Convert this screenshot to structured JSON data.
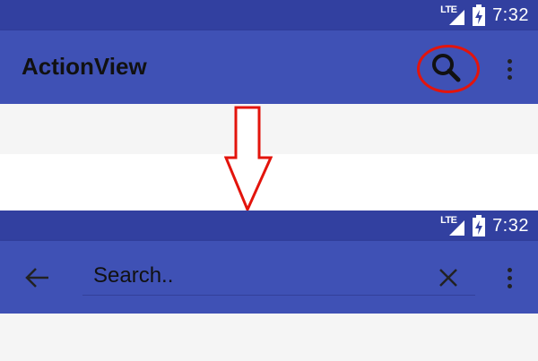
{
  "status_bar": {
    "network": "LTE",
    "time": "7:32"
  },
  "toolbar_collapsed": {
    "title": "ActionView",
    "search_icon": "search-icon",
    "overflow_icon": "more-vert-icon",
    "highlight_color": "#e3140c"
  },
  "toolbar_expanded": {
    "back_icon": "arrow-back-icon",
    "search_placeholder": "Search..",
    "clear_icon": "close-icon",
    "overflow_icon": "more-vert-icon"
  },
  "colors": {
    "status_bar": "#3240a0",
    "app_bar": "#3f51b5",
    "arrow": "#e3140c",
    "background": "#f5f5f5"
  }
}
